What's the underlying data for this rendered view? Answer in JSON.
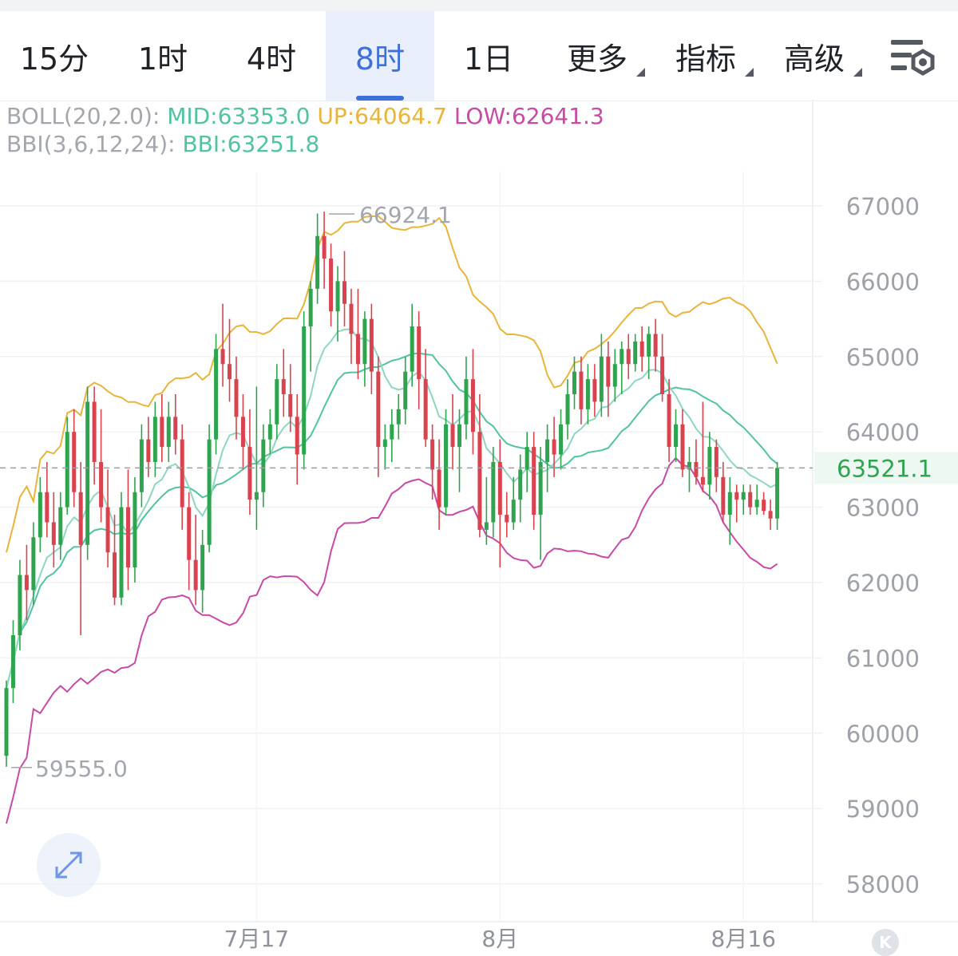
{
  "tabs": [
    {
      "label": "15分",
      "active": false,
      "dropdown": false
    },
    {
      "label": "1时",
      "active": false,
      "dropdown": false
    },
    {
      "label": "4时",
      "active": false,
      "dropdown": false
    },
    {
      "label": "8时",
      "active": true,
      "dropdown": false
    },
    {
      "label": "1日",
      "active": false,
      "dropdown": false
    },
    {
      "label": "更多",
      "active": false,
      "dropdown": true
    },
    {
      "label": "指标",
      "active": false,
      "dropdown": true
    },
    {
      "label": "高级",
      "active": false,
      "dropdown": true
    }
  ],
  "toolbar": {
    "settings_icon": "chart-settings-gear-icon"
  },
  "indicators": {
    "boll": {
      "name": "BOLL(20,2.0):",
      "mid": "MID:63353.0",
      "up": "UP:64064.7",
      "low": "LOW:62641.3"
    },
    "bbi": {
      "name": "BBI(3,6,12,24):",
      "value": "BBI:63251.8"
    }
  },
  "colors": {
    "up_candle": "#2ea44f",
    "down_candle": "#d9434f",
    "boll_mid": "#52c3a0",
    "boll_up": "#e8b43a",
    "boll_low": "#c84aa6",
    "bbi": "#52c3a0",
    "label_gray": "#a3a7ad",
    "accent": "#3f6fd8"
  },
  "buttons": {
    "expand_icon": "expand-arrows-icon",
    "k_label": "K"
  },
  "chart_data": {
    "type": "candlestick",
    "interval": "8时",
    "y_ticks": [
      58000,
      59000,
      60000,
      61000,
      62000,
      63000,
      64000,
      65000,
      66000,
      67000
    ],
    "ylim": [
      57500,
      68400
    ],
    "x_tick_labels": [
      {
        "label": "7月17",
        "index": 37
      },
      {
        "label": "8月",
        "index": 73
      },
      {
        "label": "8月16",
        "index": 109
      }
    ],
    "current_price": 63521.1,
    "high_marker": {
      "label": "66924.1",
      "value": 66924.1,
      "index": 47
    },
    "low_marker": {
      "label": "59555.0",
      "value": 59555.0,
      "index": 0
    },
    "candles": [
      [
        59700,
        60700,
        59555,
        60600
      ],
      [
        60600,
        61500,
        60400,
        61300
      ],
      [
        61300,
        62300,
        61100,
        62100
      ],
      [
        62100,
        62500,
        61500,
        61900
      ],
      [
        61900,
        62800,
        61700,
        62600
      ],
      [
        62600,
        63400,
        62400,
        63200
      ],
      [
        63200,
        63600,
        62600,
        62800
      ],
      [
        62800,
        63200,
        62200,
        62500
      ],
      [
        62500,
        63200,
        62300,
        63000
      ],
      [
        63000,
        64200,
        62900,
        64000
      ],
      [
        64000,
        64300,
        63000,
        63200
      ],
      [
        63200,
        63600,
        61300,
        62500
      ],
      [
        62500,
        64600,
        62300,
        64400
      ],
      [
        64400,
        64600,
        63300,
        63600
      ],
      [
        63600,
        64300,
        62800,
        63000
      ],
      [
        63000,
        63500,
        62200,
        62400
      ],
      [
        62400,
        62900,
        61700,
        61800
      ],
      [
        61800,
        63200,
        61700,
        63000
      ],
      [
        63000,
        63500,
        61900,
        62200
      ],
      [
        62200,
        63400,
        62000,
        63200
      ],
      [
        63200,
        64100,
        63000,
        63900
      ],
      [
        63900,
        64200,
        63400,
        63600
      ],
      [
        63600,
        64400,
        63400,
        64200
      ],
      [
        64200,
        64500,
        63600,
        63800
      ],
      [
        63800,
        64400,
        63600,
        64200
      ],
      [
        64200,
        64500,
        63700,
        63900
      ],
      [
        63900,
        64100,
        62700,
        63000
      ],
      [
        63000,
        63200,
        61900,
        62300
      ],
      [
        62300,
        62900,
        61700,
        61900
      ],
      [
        61900,
        62700,
        61600,
        62500
      ],
      [
        62500,
        64100,
        62400,
        63900
      ],
      [
        63900,
        65300,
        63700,
        65100
      ],
      [
        65100,
        65700,
        64600,
        64900
      ],
      [
        64900,
        65500,
        64400,
        64700
      ],
      [
        64700,
        65000,
        63900,
        64200
      ],
      [
        64200,
        64500,
        63500,
        63800
      ],
      [
        63800,
        64300,
        62900,
        63100
      ],
      [
        63100,
        64600,
        62700,
        63200
      ],
      [
        63200,
        64100,
        63000,
        63900
      ],
      [
        63900,
        64300,
        63700,
        64100
      ],
      [
        64100,
        64900,
        63900,
        64700
      ],
      [
        64700,
        65100,
        64200,
        64500
      ],
      [
        64500,
        64900,
        64000,
        64200
      ],
      [
        64200,
        64500,
        63300,
        63700
      ],
      [
        63700,
        65600,
        63500,
        65400
      ],
      [
        65400,
        66000,
        64800,
        65900
      ],
      [
        65900,
        66900,
        65700,
        66600
      ],
      [
        66600,
        66924.1,
        65900,
        66300
      ],
      [
        66300,
        66500,
        65400,
        65600
      ],
      [
        65600,
        66200,
        65200,
        66000
      ],
      [
        66000,
        66400,
        65400,
        65700
      ],
      [
        65700,
        65900,
        64900,
        65300
      ],
      [
        65300,
        65900,
        64700,
        64900
      ],
      [
        64900,
        65600,
        64600,
        65500
      ],
      [
        65500,
        65700,
        64500,
        64800
      ],
      [
        64800,
        65000,
        63400,
        63800
      ],
      [
        63800,
        64100,
        63500,
        63900
      ],
      [
        63900,
        64300,
        63600,
        64100
      ],
      [
        64100,
        64500,
        63900,
        64300
      ],
      [
        64300,
        65000,
        64100,
        64800
      ],
      [
        64800,
        65700,
        64600,
        65400
      ],
      [
        65400,
        65600,
        64300,
        64700
      ],
      [
        64700,
        65100,
        63800,
        63900
      ],
      [
        63900,
        64100,
        63100,
        63500
      ],
      [
        63500,
        63900,
        62700,
        63000
      ],
      [
        63000,
        64300,
        62900,
        64100
      ],
      [
        64100,
        64500,
        63500,
        63800
      ],
      [
        63800,
        64300,
        63200,
        64100
      ],
      [
        64100,
        65000,
        63900,
        64700
      ],
      [
        64700,
        65100,
        63700,
        64000
      ],
      [
        64000,
        64500,
        62600,
        62700
      ],
      [
        62700,
        63400,
        62500,
        62800
      ],
      [
        62800,
        63800,
        62600,
        63600
      ],
      [
        63600,
        63900,
        62200,
        62900
      ],
      [
        62900,
        63200,
        62600,
        62800
      ],
      [
        62800,
        63400,
        62700,
        63100
      ],
      [
        63100,
        63700,
        62800,
        63500
      ],
      [
        63500,
        64000,
        63200,
        63800
      ],
      [
        63800,
        64000,
        62700,
        62900
      ],
      [
        62900,
        63800,
        62300,
        63600
      ],
      [
        63600,
        64100,
        63200,
        63900
      ],
      [
        63900,
        64200,
        63400,
        63700
      ],
      [
        63700,
        64300,
        63500,
        64100
      ],
      [
        64100,
        64700,
        63900,
        64500
      ],
      [
        64500,
        65000,
        64300,
        64800
      ],
      [
        64800,
        65000,
        64100,
        64300
      ],
      [
        64300,
        64900,
        64100,
        64700
      ],
      [
        64700,
        64900,
        64200,
        64400
      ],
      [
        64400,
        65300,
        64200,
        65000
      ],
      [
        65000,
        65200,
        64200,
        64600
      ],
      [
        64600,
        65100,
        64400,
        64900
      ],
      [
        64900,
        65200,
        64500,
        65100
      ],
      [
        65100,
        65300,
        64700,
        64900
      ],
      [
        64900,
        65300,
        64800,
        65200
      ],
      [
        65200,
        65400,
        64800,
        65000
      ],
      [
        65000,
        65400,
        64700,
        65300
      ],
      [
        65300,
        65500,
        64800,
        65000
      ],
      [
        65000,
        65300,
        64400,
        64500
      ],
      [
        64500,
        64700,
        63600,
        63800
      ],
      [
        63800,
        64300,
        63600,
        64100
      ],
      [
        64100,
        64300,
        63400,
        63500
      ],
      [
        63500,
        63800,
        63200,
        63600
      ],
      [
        63600,
        63900,
        63300,
        63400
      ],
      [
        63400,
        64400,
        63200,
        63300
      ],
      [
        63300,
        64000,
        63100,
        63800
      ],
      [
        63800,
        63900,
        63200,
        63400
      ],
      [
        63400,
        63600,
        62800,
        62900
      ],
      [
        62900,
        63400,
        62500,
        63200
      ],
      [
        63200,
        63300,
        62800,
        63100
      ],
      [
        63100,
        63300,
        62900,
        63200
      ],
      [
        63200,
        63300,
        62900,
        63000
      ],
      [
        63000,
        63300,
        62900,
        63100
      ],
      [
        63100,
        63200,
        62900,
        62950
      ],
      [
        62950,
        63100,
        62700,
        62850
      ],
      [
        62850,
        63600,
        62700,
        63521.1
      ]
    ],
    "series": [
      {
        "name": "MID",
        "last": 63353.0
      },
      {
        "name": "UP",
        "last": 64064.7
      },
      {
        "name": "LOW",
        "last": 62641.3
      },
      {
        "name": "BBI",
        "last": 63251.8
      }
    ]
  }
}
